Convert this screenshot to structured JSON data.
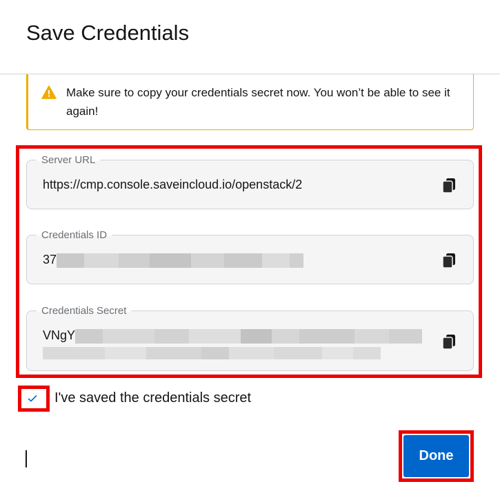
{
  "modal": {
    "title": "Save Credentials"
  },
  "warning": {
    "icon": "warning-triangle-icon",
    "color": "#f0ab00",
    "text": "Make sure to copy your credentials secret now. You won’t be able to see it again!"
  },
  "fields": {
    "server_url": {
      "label": "Server URL",
      "value": "https://cmp.console.saveincloud.io/openstack/2",
      "copy_icon": "copy-icon"
    },
    "credentials_id": {
      "label": "Credentials ID",
      "value_visible": "37",
      "redacted": true,
      "copy_icon": "copy-icon"
    },
    "credentials_secret": {
      "label": "Credentials Secret",
      "value_visible": "VNgY",
      "redacted": true,
      "copy_icon": "copy-icon"
    }
  },
  "confirmation": {
    "checked": true,
    "label": "I've saved the credentials secret",
    "check_color": "#0066cc"
  },
  "actions": {
    "done_label": "Done",
    "done_color": "#0066cc"
  },
  "annotations": {
    "highlight_color": "#ec0000"
  }
}
